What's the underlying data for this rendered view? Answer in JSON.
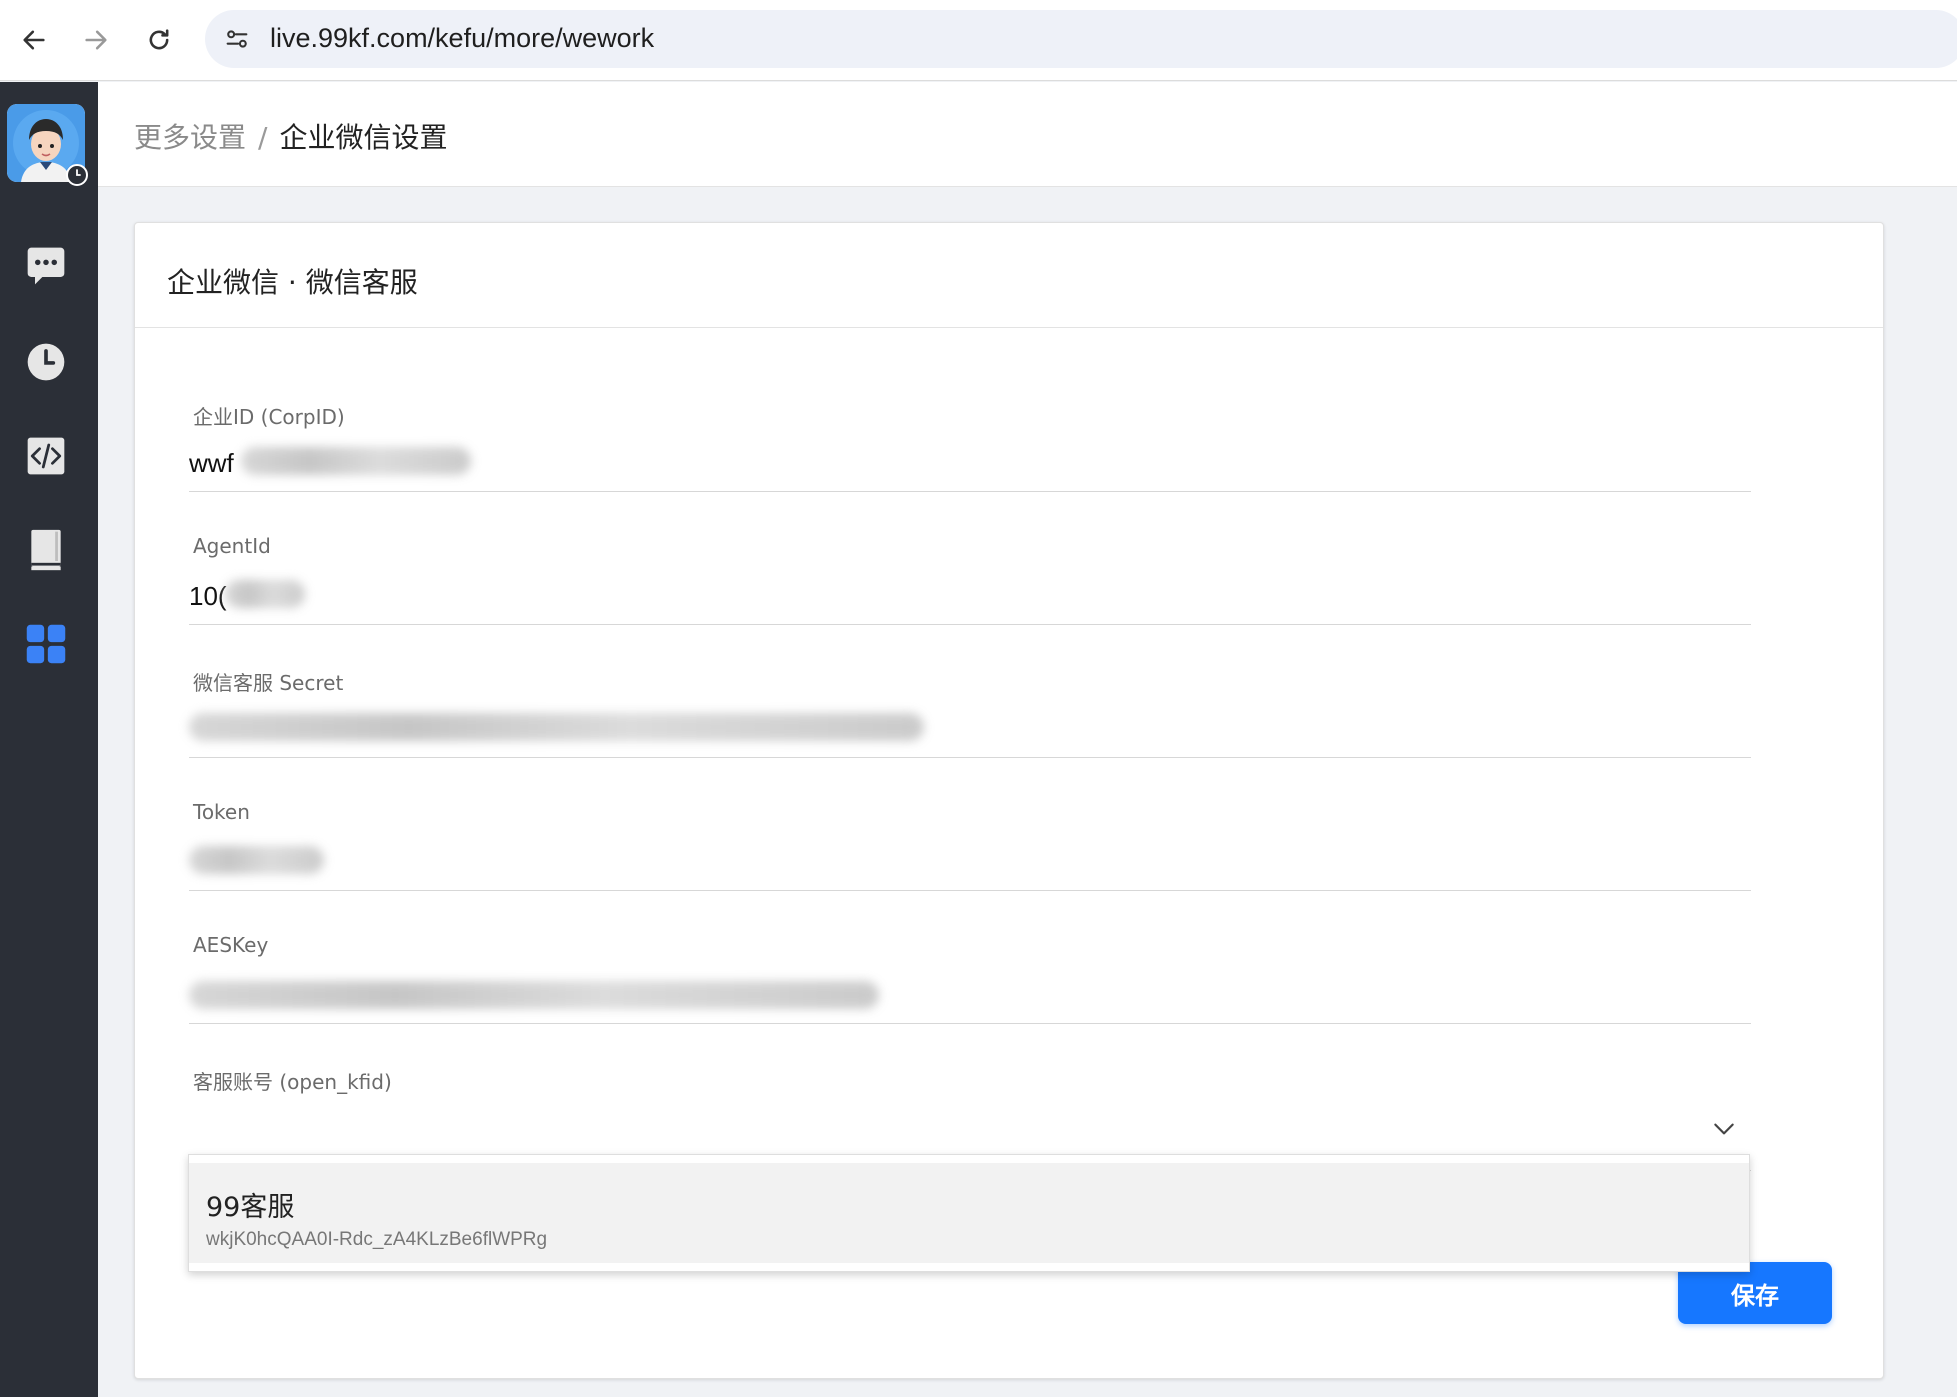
{
  "browser": {
    "url": "live.99kf.com/kefu/more/wework"
  },
  "sidebar": {
    "items": [
      {
        "icon": "chat-bubble-icon"
      },
      {
        "icon": "clock-icon"
      },
      {
        "icon": "code-icon"
      },
      {
        "icon": "book-icon"
      },
      {
        "icon": "grid-apps-icon",
        "active": true
      }
    ],
    "active_color": "#3b82f6"
  },
  "header": {
    "breadcrumb_parent": "更多设置",
    "breadcrumb_sep": "/",
    "breadcrumb_current": "企业微信设置"
  },
  "card": {
    "title": "企业微信 · 微信客服"
  },
  "form": {
    "corpid_label": "企业ID (CorpID)",
    "corpid_value": "wwf",
    "agentid_label": "AgentId",
    "agentid_value": "10(",
    "secret_label": "微信客服 Secret",
    "token_label": "Token",
    "aeskey_label": "AESKey",
    "kfid_label": "客服账号 (open_kfid)"
  },
  "dropdown": {
    "option_title": "99客服",
    "option_id": "wkjK0hcQAA0I-Rdc_zA4KLzBe6flWPRg"
  },
  "actions": {
    "save_label": "保存"
  },
  "colors": {
    "primary": "#1677ff",
    "sidebar_bg": "#2b2f37"
  }
}
